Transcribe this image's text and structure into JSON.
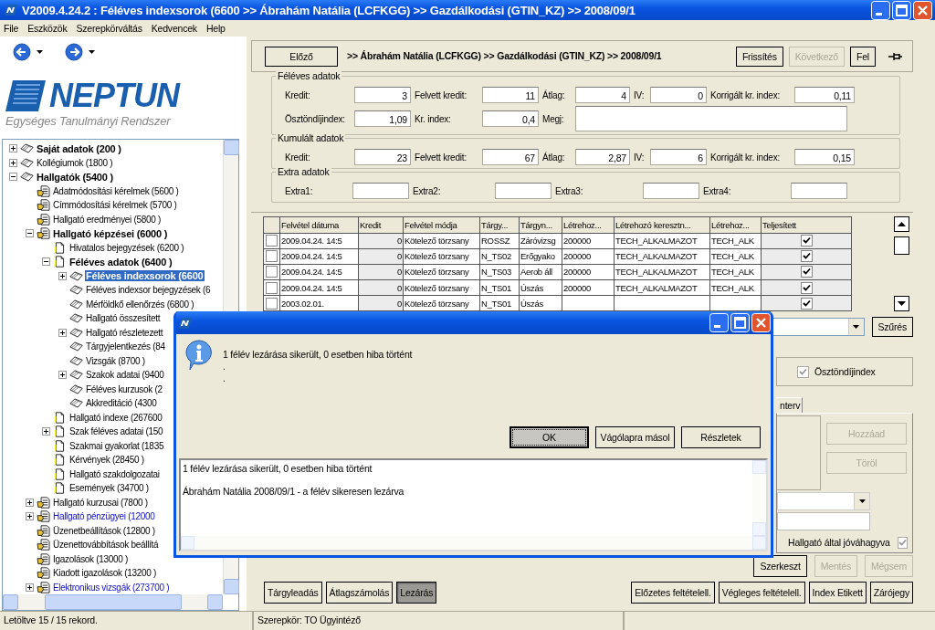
{
  "window": {
    "title": "V2009.4.24.2 : Féléves indexsorok (6600  >> Ábrahám Natália (LCFKGG) >> Gazdálkodási (GTIN_KZ) >> 2008/09/1"
  },
  "menu": [
    "File",
    "Eszközök",
    "Szerepkörváltás",
    "Kedvencek",
    "Help"
  ],
  "logo": {
    "name": "NEPTUN",
    "subtitle": "Egységes Tanulmányi Rendszer"
  },
  "tree": [
    {
      "label": "Saját adatok (200  )",
      "kind": "book",
      "bold": true,
      "link": false,
      "selected": false,
      "expanded": false
    },
    {
      "label": "Kollégiumok (1800  )",
      "kind": "book",
      "bold": false,
      "link": false,
      "selected": false,
      "expanded": false
    },
    {
      "label": "Hallgatók (5400  )",
      "kind": "book",
      "bold": true,
      "link": false,
      "selected": false,
      "expanded": true,
      "children": [
        {
          "label": "Adatmódosítási kérelmek (5600  )",
          "kind": "hand",
          "bold": false,
          "link": false,
          "selected": false
        },
        {
          "label": "Címmódosítási kérelmek (5700  )",
          "kind": "hand",
          "bold": false,
          "link": false,
          "selected": false
        },
        {
          "label": "Hallgató eredményei (5800  )",
          "kind": "hand",
          "bold": false,
          "link": false,
          "selected": false
        },
        {
          "label": "Hallgató képzései (6000  )",
          "kind": "hand",
          "bold": true,
          "link": false,
          "selected": false,
          "expanded": true,
          "children": [
            {
              "label": "Hivatalos bejegyzések (6200  )",
              "kind": "doc",
              "bold": false,
              "link": false,
              "selected": false
            },
            {
              "label": "Féléves adatok (6400  )",
              "kind": "doc",
              "bold": true,
              "link": false,
              "selected": false,
              "expanded": true,
              "children": [
                {
                  "label": "Féléves indexsorok (6600",
                  "kind": "book",
                  "bold": true,
                  "link": false,
                  "selected": true,
                  "expanded": false
                },
                {
                  "label": "Féléves indexsor bejegyzések (6",
                  "kind": "book",
                  "bold": false,
                  "link": false,
                  "selected": false
                },
                {
                  "label": "Mérföldkő ellenőrzés (6800  )",
                  "kind": "book",
                  "bold": false,
                  "link": false,
                  "selected": false
                },
                {
                  "label": "Hallgató összesített",
                  "kind": "book",
                  "bold": false,
                  "link": false,
                  "selected": false
                },
                {
                  "label": "Hallgató részletezett",
                  "kind": "book",
                  "bold": false,
                  "link": false,
                  "selected": false,
                  "expanded": false
                },
                {
                  "label": "Tárgyjelentkezés (84",
                  "kind": "book",
                  "bold": false,
                  "link": false,
                  "selected": false
                },
                {
                  "label": "Vizsgák (8700  )",
                  "kind": "book",
                  "bold": false,
                  "link": false,
                  "selected": false
                },
                {
                  "label": "Szakok adatai (9400",
                  "kind": "book",
                  "bold": false,
                  "link": false,
                  "selected": false,
                  "expanded": false
                },
                {
                  "label": "Féléves kurzusok (2",
                  "kind": "book",
                  "bold": false,
                  "link": false,
                  "selected": false
                },
                {
                  "label": "Akkreditáció (4300",
                  "kind": "book",
                  "bold": false,
                  "link": false,
                  "selected": false
                }
              ]
            },
            {
              "label": "Hallgató indexe (267600",
              "kind": "doc",
              "bold": false,
              "link": false,
              "selected": false
            },
            {
              "label": "Szak féléves adatai (150",
              "kind": "doc",
              "bold": false,
              "link": false,
              "selected": false,
              "expanded": false
            },
            {
              "label": "Szakmai gyakorlat (1835",
              "kind": "doc",
              "bold": false,
              "link": false,
              "selected": false
            },
            {
              "label": "Kérvények (28450  )",
              "kind": "doc",
              "bold": false,
              "link": false,
              "selected": false
            },
            {
              "label": "Hallgató szakdolgozatai",
              "kind": "doc",
              "bold": false,
              "link": false,
              "selected": false
            },
            {
              "label": "Események (34700  )",
              "kind": "doc",
              "bold": false,
              "link": false,
              "selected": false
            }
          ]
        },
        {
          "label": "Hallgató kurzusai (7800  )",
          "kind": "hand",
          "bold": false,
          "link": false,
          "selected": false,
          "expanded": false
        },
        {
          "label": "Hallgató pénzügyei (12000",
          "kind": "hand",
          "bold": false,
          "link": true,
          "selected": false,
          "expanded": false
        },
        {
          "label": "Üzenetbeállítások (12800  )",
          "kind": "hand",
          "bold": false,
          "link": false,
          "selected": false
        },
        {
          "label": "Üzenettovábbítások beállítá",
          "kind": "hand",
          "bold": false,
          "link": false,
          "selected": false
        },
        {
          "label": "Igazolások (13000  )",
          "kind": "hand",
          "bold": false,
          "link": false,
          "selected": false
        },
        {
          "label": "Kiadott igazolások (13200  )",
          "kind": "hand",
          "bold": false,
          "link": false,
          "selected": false
        },
        {
          "label": "Elektronikus vizsgák (273700  )",
          "kind": "hand",
          "bold": false,
          "link": true,
          "selected": false,
          "expanded": false
        }
      ]
    }
  ],
  "header": {
    "prev_button": "Előző",
    "breadcrumb": ">> Ábrahám Natália (LCFKGG) >> Gazdálkodási (GTIN_KZ) >> 2008/09/1",
    "buttons": [
      {
        "label": "Frissítés",
        "disabled": false
      },
      {
        "label": "Következő",
        "disabled": true
      },
      {
        "label": "Fel",
        "disabled": false
      }
    ]
  },
  "groups": [
    {
      "title": "Féléves adatok",
      "kind": "main",
      "fields": [
        {
          "label": "Kredit:",
          "value": "3"
        },
        {
          "label": "Felvett kredit:",
          "value": "11"
        },
        {
          "label": "Átlag:",
          "value": "4"
        },
        {
          "label": "IV:",
          "value": "0"
        },
        {
          "label": "Korrigált kr. index:",
          "value": "0,11"
        },
        {
          "label": "Ösztöndíjindex:",
          "value": "1,09"
        },
        {
          "label": "Kr. index:",
          "value": "0,4"
        },
        {
          "label": "Megj:",
          "kind": "note"
        }
      ]
    },
    {
      "title": "Kumulált adatok",
      "kind": "main",
      "fields": [
        {
          "label": "Kredit:",
          "value": "23"
        },
        {
          "label": "Felvett kredit:",
          "value": "67"
        },
        {
          "label": "Átlag:",
          "value": "2,87"
        },
        {
          "label": "IV:",
          "value": "6"
        },
        {
          "label": "Korrigált kr. index:",
          "value": "0,15"
        }
      ]
    },
    {
      "title": "Extra adatok",
      "kind": "extra",
      "fields": [
        {
          "label": "Extra1:"
        },
        {
          "label": "Extra2:"
        },
        {
          "label": "Extra3:"
        },
        {
          "label": "Extra4:"
        }
      ]
    }
  ],
  "table": {
    "columns": [
      "Felvétel dátuma",
      "Kredit",
      "Felvétel módja",
      "Tárgy...",
      "Tárgyn...",
      "Létrehoz...",
      "Létrehozó keresztn...",
      "Létrehoz...",
      "Teljesített"
    ],
    "rows": [
      {
        "checked": false,
        "completed": true,
        "cells": [
          "2009.04.24. 14:5",
          "0",
          "Kötelező törzsany",
          "ROSSZ",
          "Záróvizsg",
          "200000",
          "TECH_ALKALMAZOT",
          "TECH_ALK"
        ]
      },
      {
        "checked": false,
        "completed": true,
        "cells": [
          "2009.04.24. 14:5",
          "0",
          "Kötelező törzsany",
          "N_TS02",
          "Erőgyako",
          "200000",
          "TECH_ALKALMAZOT",
          "TECH_ALK"
        ]
      },
      {
        "checked": false,
        "completed": true,
        "cells": [
          "2009.04.24. 14:5",
          "0",
          "Kötelező törzsany",
          "N_TS03",
          "Aerob áll",
          "200000",
          "TECH_ALKALMAZOT",
          "TECH_ALK"
        ]
      },
      {
        "checked": false,
        "completed": true,
        "cells": [
          "2009.04.24. 14:5",
          "0",
          "Kötelező törzsany",
          "N_TS01",
          "Úszás",
          "200000",
          "TECH_ALKALMAZOT",
          "TECH_ALK"
        ]
      },
      {
        "checked": false,
        "completed": true,
        "cells": [
          "2003.02.01.",
          "0",
          "Kötelező törzsany",
          "N_TS01",
          "Úszás",
          null,
          null,
          null
        ]
      }
    ]
  },
  "filter_button": "Szűrés",
  "scholarship_check": {
    "label": "Ösztöndíjindex",
    "checked": true
  },
  "tab": {
    "label": "nterv"
  },
  "tab_buttons": [
    {
      "label": "Hozzáad",
      "disabled": true
    },
    {
      "label": "Töröl",
      "disabled": true
    }
  ],
  "approved_check": {
    "label": "Hallgató által jóváhagyva",
    "checked": true
  },
  "edit_buttons": [
    {
      "label": "Szerkeszt",
      "disabled": false
    },
    {
      "label": "Mentés",
      "disabled": true
    },
    {
      "label": "Mégsem",
      "disabled": true
    }
  ],
  "bottom_left": [
    {
      "label": "Tárgyleadás",
      "pressed": false
    },
    {
      "label": "Átlagszámolás",
      "pressed": false
    },
    {
      "label": "Lezárás",
      "pressed": true
    }
  ],
  "bottom_right": [
    {
      "label": "Előzetes feltételell.",
      "pressed": false
    },
    {
      "label": "Végleges feltételell.",
      "pressed": false
    },
    {
      "label": "Index Etikett",
      "pressed": false
    },
    {
      "label": "Zárójegy",
      "pressed": false
    }
  ],
  "status_bar": [
    "Letöltve 15 / 15 rekord.",
    "Szerepkör: TO Ügyintéző"
  ],
  "dialog": {
    "message": "1 félév lezárása sikerült, 0 esetben hiba történt",
    "extra_lines": [
      ".",
      "."
    ],
    "buttons": [
      {
        "label": "OK",
        "default": true
      },
      {
        "label": "Vágólapra másol",
        "default": false
      },
      {
        "label": "Részletek",
        "default": false
      }
    ],
    "details": [
      "1 félév lezárása sikerült, 0 esetben hiba történt",
      "Ábrahám Natália 2008/09/1 - a félév sikeresen lezárva"
    ]
  }
}
